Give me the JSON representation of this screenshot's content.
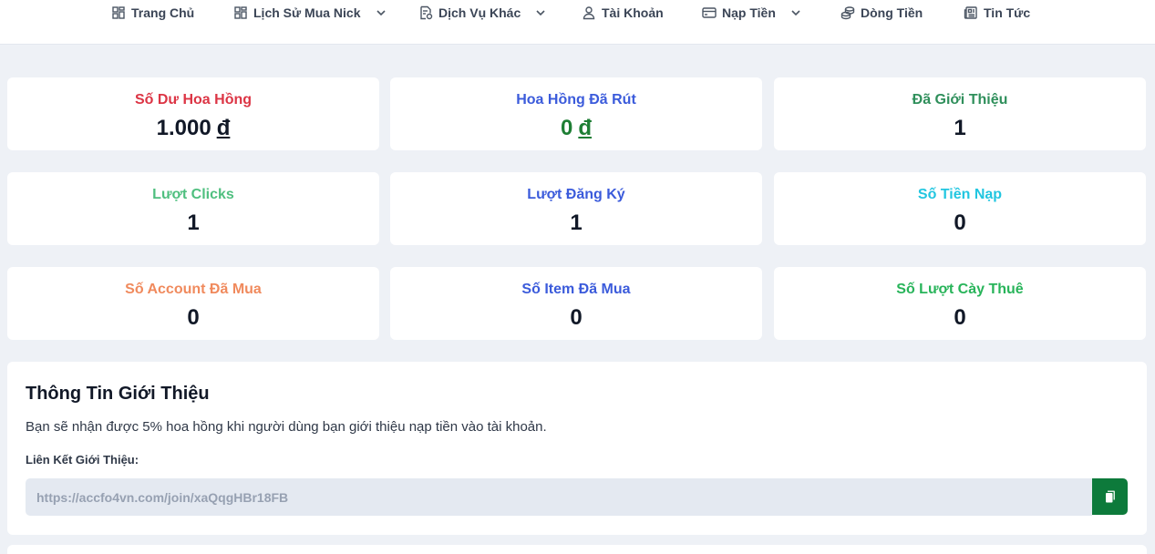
{
  "nav": {
    "items": [
      {
        "label": "Trang Chủ",
        "icon": "grid-icon",
        "dropdown": false
      },
      {
        "label": "Lịch Sử Mua Nick",
        "icon": "grid-icon",
        "dropdown": true
      },
      {
        "label": "Dịch Vụ Khác",
        "icon": "document-settings-icon",
        "dropdown": true
      },
      {
        "label": "Tài Khoản",
        "icon": "user-icon",
        "dropdown": false
      },
      {
        "label": "Nạp Tiền",
        "icon": "credit-card-icon",
        "dropdown": true
      },
      {
        "label": "Dòng Tiền",
        "icon": "coins-icon",
        "dropdown": false
      },
      {
        "label": "Tin Tức",
        "icon": "newspaper-icon",
        "dropdown": false
      }
    ]
  },
  "stats": [
    {
      "label": "Số Dư Hoa Hồng",
      "value": "1.000",
      "currency": "đ",
      "color": "#dc3545"
    },
    {
      "label": "Hoa Hồng Đã Rút",
      "value": "0",
      "currency": "đ",
      "color": "#3b5bdb",
      "value_color": "#1e7e34"
    },
    {
      "label": "Đã Giới Thiệu",
      "value": "1",
      "color": "#2f8f5b"
    },
    {
      "label": "Lượt Clicks",
      "value": "1",
      "color": "#4fbf7f"
    },
    {
      "label": "Lượt Đăng Ký",
      "value": "1",
      "color": "#3b5bdb"
    },
    {
      "label": "Số Tiền Nạp",
      "value": "0",
      "color": "#22c6e0"
    },
    {
      "label": "Số Account Đã Mua",
      "value": "0",
      "color": "#f08a5d"
    },
    {
      "label": "Số Item Đã Mua",
      "value": "0",
      "color": "#3b5bdb"
    },
    {
      "label": "Số Lượt Cày Thuê",
      "value": "0",
      "color": "#28b45a"
    }
  ],
  "referral": {
    "title": "Thông Tin Giới Thiệu",
    "description": "Bạn sẽ nhận được 5% hoa hồng khi người dùng bạn giới thiệu nạp tiền vào tài khoản.",
    "link_label": "Liên Kết Giới Thiệu:",
    "link_value": "https://accfo4vn.com/join/xaQqgHBr18FB",
    "copy_icon": "copy-icon",
    "button_color": "#0d7a3b"
  }
}
